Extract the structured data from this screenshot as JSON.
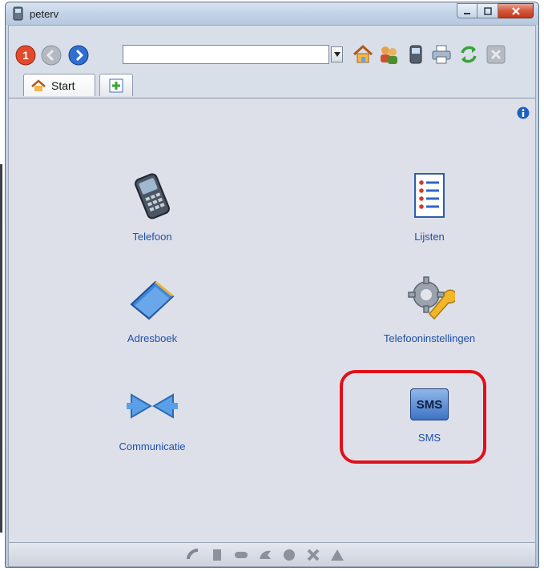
{
  "window": {
    "title": "peterv"
  },
  "toolbar": {
    "url_value": "",
    "url_placeholder": "",
    "icons": [
      "stop-icon",
      "back-icon",
      "forward-icon",
      "dropdown-icon",
      "home-icon",
      "contacts-icon",
      "phone-sync-icon",
      "print-icon",
      "refresh-icon",
      "close-icon"
    ]
  },
  "tabs": [
    {
      "label": "Start",
      "icon": "home-icon"
    },
    {
      "label": "",
      "icon": "add-tab-icon"
    }
  ],
  "tiles": [
    {
      "label": "Telefoon",
      "icon": "phone-icon"
    },
    {
      "label": "Lijsten",
      "icon": "list-icon"
    },
    {
      "label": "Adresboek",
      "icon": "address-book-icon"
    },
    {
      "label": "Telefooninstellingen",
      "icon": "settings-icon"
    },
    {
      "label": "Communicatie",
      "icon": "communication-icon"
    },
    {
      "label": "SMS",
      "icon": "sms-icon",
      "badge": "SMS",
      "highlighted": true
    }
  ],
  "statusbar": {
    "icons": [
      "call-icon",
      "dial-icon",
      "end-call-icon",
      "reject-icon",
      "mute-icon",
      "clear-icon",
      "alert-icon"
    ]
  },
  "colors": {
    "highlight": "#e0101a",
    "link": "#1c4fa8",
    "close_button": "#c7381c"
  }
}
